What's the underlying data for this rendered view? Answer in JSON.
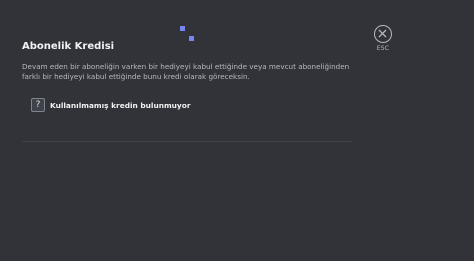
{
  "header": {
    "title": "Abonelik Kredisi",
    "close_label": "ESC"
  },
  "content": {
    "description": "Devam eden bir aboneliğin varken bir hediyeyi kabul ettiğinde veya mevcut aboneliğinden farklı bir hediyeyi kabul ettiğinde bunu kredi olarak göreceksin.",
    "empty_icon": "question-mark-icon",
    "empty_glyph": "?",
    "empty_text": "Kullanılmamış kredin bulunmuyor"
  },
  "colors": {
    "background": "#313338",
    "accent": "#7984f5",
    "text_primary": "#f2f3f5",
    "text_muted": "#b5bac1"
  }
}
